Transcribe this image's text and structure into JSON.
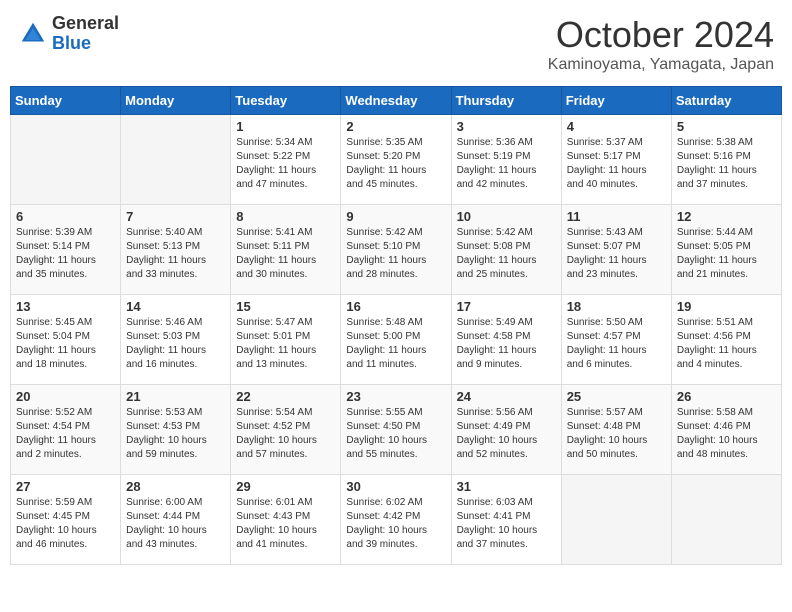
{
  "header": {
    "logo_general": "General",
    "logo_blue": "Blue",
    "month": "October 2024",
    "location": "Kaminoyama, Yamagata, Japan"
  },
  "days_of_week": [
    "Sunday",
    "Monday",
    "Tuesday",
    "Wednesday",
    "Thursday",
    "Friday",
    "Saturday"
  ],
  "weeks": [
    [
      {
        "day": "",
        "info": ""
      },
      {
        "day": "",
        "info": ""
      },
      {
        "day": "1",
        "info": "Sunrise: 5:34 AM\nSunset: 5:22 PM\nDaylight: 11 hours and 47 minutes."
      },
      {
        "day": "2",
        "info": "Sunrise: 5:35 AM\nSunset: 5:20 PM\nDaylight: 11 hours and 45 minutes."
      },
      {
        "day": "3",
        "info": "Sunrise: 5:36 AM\nSunset: 5:19 PM\nDaylight: 11 hours and 42 minutes."
      },
      {
        "day": "4",
        "info": "Sunrise: 5:37 AM\nSunset: 5:17 PM\nDaylight: 11 hours and 40 minutes."
      },
      {
        "day": "5",
        "info": "Sunrise: 5:38 AM\nSunset: 5:16 PM\nDaylight: 11 hours and 37 minutes."
      }
    ],
    [
      {
        "day": "6",
        "info": "Sunrise: 5:39 AM\nSunset: 5:14 PM\nDaylight: 11 hours and 35 minutes."
      },
      {
        "day": "7",
        "info": "Sunrise: 5:40 AM\nSunset: 5:13 PM\nDaylight: 11 hours and 33 minutes."
      },
      {
        "day": "8",
        "info": "Sunrise: 5:41 AM\nSunset: 5:11 PM\nDaylight: 11 hours and 30 minutes."
      },
      {
        "day": "9",
        "info": "Sunrise: 5:42 AM\nSunset: 5:10 PM\nDaylight: 11 hours and 28 minutes."
      },
      {
        "day": "10",
        "info": "Sunrise: 5:42 AM\nSunset: 5:08 PM\nDaylight: 11 hours and 25 minutes."
      },
      {
        "day": "11",
        "info": "Sunrise: 5:43 AM\nSunset: 5:07 PM\nDaylight: 11 hours and 23 minutes."
      },
      {
        "day": "12",
        "info": "Sunrise: 5:44 AM\nSunset: 5:05 PM\nDaylight: 11 hours and 21 minutes."
      }
    ],
    [
      {
        "day": "13",
        "info": "Sunrise: 5:45 AM\nSunset: 5:04 PM\nDaylight: 11 hours and 18 minutes."
      },
      {
        "day": "14",
        "info": "Sunrise: 5:46 AM\nSunset: 5:03 PM\nDaylight: 11 hours and 16 minutes."
      },
      {
        "day": "15",
        "info": "Sunrise: 5:47 AM\nSunset: 5:01 PM\nDaylight: 11 hours and 13 minutes."
      },
      {
        "day": "16",
        "info": "Sunrise: 5:48 AM\nSunset: 5:00 PM\nDaylight: 11 hours and 11 minutes."
      },
      {
        "day": "17",
        "info": "Sunrise: 5:49 AM\nSunset: 4:58 PM\nDaylight: 11 hours and 9 minutes."
      },
      {
        "day": "18",
        "info": "Sunrise: 5:50 AM\nSunset: 4:57 PM\nDaylight: 11 hours and 6 minutes."
      },
      {
        "day": "19",
        "info": "Sunrise: 5:51 AM\nSunset: 4:56 PM\nDaylight: 11 hours and 4 minutes."
      }
    ],
    [
      {
        "day": "20",
        "info": "Sunrise: 5:52 AM\nSunset: 4:54 PM\nDaylight: 11 hours and 2 minutes."
      },
      {
        "day": "21",
        "info": "Sunrise: 5:53 AM\nSunset: 4:53 PM\nDaylight: 10 hours and 59 minutes."
      },
      {
        "day": "22",
        "info": "Sunrise: 5:54 AM\nSunset: 4:52 PM\nDaylight: 10 hours and 57 minutes."
      },
      {
        "day": "23",
        "info": "Sunrise: 5:55 AM\nSunset: 4:50 PM\nDaylight: 10 hours and 55 minutes."
      },
      {
        "day": "24",
        "info": "Sunrise: 5:56 AM\nSunset: 4:49 PM\nDaylight: 10 hours and 52 minutes."
      },
      {
        "day": "25",
        "info": "Sunrise: 5:57 AM\nSunset: 4:48 PM\nDaylight: 10 hours and 50 minutes."
      },
      {
        "day": "26",
        "info": "Sunrise: 5:58 AM\nSunset: 4:46 PM\nDaylight: 10 hours and 48 minutes."
      }
    ],
    [
      {
        "day": "27",
        "info": "Sunrise: 5:59 AM\nSunset: 4:45 PM\nDaylight: 10 hours and 46 minutes."
      },
      {
        "day": "28",
        "info": "Sunrise: 6:00 AM\nSunset: 4:44 PM\nDaylight: 10 hours and 43 minutes."
      },
      {
        "day": "29",
        "info": "Sunrise: 6:01 AM\nSunset: 4:43 PM\nDaylight: 10 hours and 41 minutes."
      },
      {
        "day": "30",
        "info": "Sunrise: 6:02 AM\nSunset: 4:42 PM\nDaylight: 10 hours and 39 minutes."
      },
      {
        "day": "31",
        "info": "Sunrise: 6:03 AM\nSunset: 4:41 PM\nDaylight: 10 hours and 37 minutes."
      },
      {
        "day": "",
        "info": ""
      },
      {
        "day": "",
        "info": ""
      }
    ]
  ]
}
